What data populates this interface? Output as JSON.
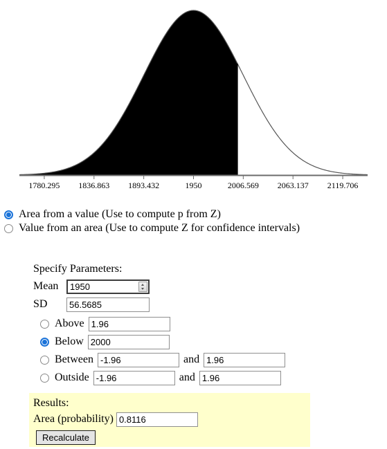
{
  "chart_data": {
    "type": "area",
    "title": "",
    "xlabel": "",
    "ylabel": "",
    "distribution": "normal",
    "mean": 1950,
    "sd": 56.5685,
    "shaded_region": "below",
    "shade_boundary": 2000,
    "shade_color": "#000000",
    "curve_color": "#555555",
    "axis_color": "#6b6b6b",
    "grid": false,
    "legend": "none",
    "xlim": [
      1752.01,
      2147.99
    ],
    "tick_labels": [
      "1780.295",
      "1836.863",
      "1893.432",
      "1950",
      "2006.569",
      "2063.137",
      "2119.706"
    ],
    "tick_values": [
      1780.295,
      1836.863,
      1893.432,
      1950,
      2006.569,
      2063.137,
      2119.706
    ]
  },
  "modes": {
    "items": [
      {
        "label": "Area from a value (Use to compute p from Z)",
        "selected": true
      },
      {
        "label": "Value from an area (Use to compute Z for confidence intervals)",
        "selected": false
      }
    ]
  },
  "parameters": {
    "heading": "Specify Parameters:",
    "mean": {
      "label": "Mean",
      "value": "1950",
      "focused": true,
      "spinner": "number-spinner-icon"
    },
    "sd": {
      "label": "SD",
      "value": "56.5685",
      "focused": false
    }
  },
  "conditions": {
    "items": [
      {
        "label": "Above",
        "selected": false,
        "value1": "1.96",
        "and": null,
        "value2": null
      },
      {
        "label": "Below",
        "selected": true,
        "value1": "2000",
        "and": null,
        "value2": null
      },
      {
        "label": "Between",
        "selected": false,
        "value1": "-1.96",
        "and": "and",
        "value2": "1.96"
      },
      {
        "label": "Outside",
        "selected": false,
        "value1": "-1.96",
        "and": "and",
        "value2": "1.96"
      }
    ]
  },
  "results": {
    "heading": "Results:",
    "area_label": "Area (probability)",
    "area_value": "0.8116",
    "recalculate_label": "Recalculate",
    "panel_color": "#ffffcc"
  }
}
